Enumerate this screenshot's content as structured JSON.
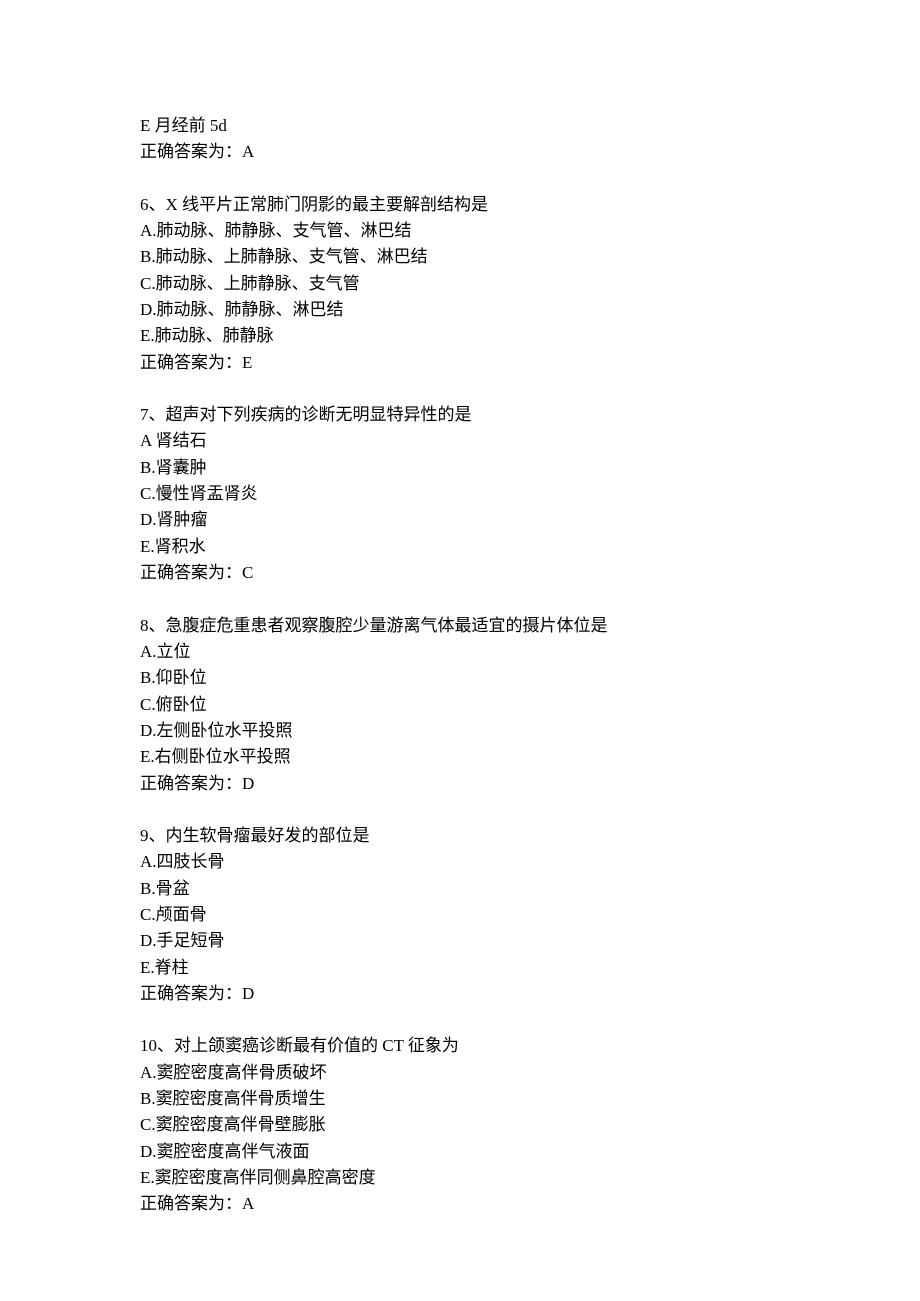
{
  "questions": [
    {
      "num": "",
      "stem": "E 月经前 5d",
      "options": [],
      "answer_label": "正确答案为：",
      "answer": "A"
    },
    {
      "num": "6、",
      "stem": "X 线平片正常肺门阴影的最主要解剖结构是",
      "options": [
        "A.肺动脉、肺静脉、支气管、淋巴结",
        "B.肺动脉、上肺静脉、支气管、淋巴结",
        "C.肺动脉、上肺静脉、支气管",
        "D.肺动脉、肺静脉、淋巴结",
        "E.肺动脉、肺静脉"
      ],
      "answer_label": "正确答案为：",
      "answer": "E"
    },
    {
      "num": "7、",
      "stem": "超声对下列疾病的诊断无明显特异性的是",
      "options": [
        "A 肾结石",
        "B.肾囊肿",
        "C.慢性肾盂肾炎",
        "D.肾肿瘤",
        "E.肾积水"
      ],
      "answer_label": "正确答案为：",
      "answer": "C"
    },
    {
      "num": "8、",
      "stem": "急腹症危重患者观察腹腔少量游离气体最适宜的摄片体位是",
      "options": [
        "A.立位",
        "B.仰卧位",
        "C.俯卧位",
        "D.左侧卧位水平投照",
        "E.右侧卧位水平投照"
      ],
      "answer_label": "正确答案为：",
      "answer": "D"
    },
    {
      "num": "9、",
      "stem": "内生软骨瘤最好发的部位是",
      "options": [
        "A.四肢长骨",
        "B.骨盆",
        "C.颅面骨",
        "D.手足短骨",
        "E.脊柱"
      ],
      "answer_label": "正确答案为：",
      "answer": "D"
    },
    {
      "num": "10、",
      "stem": "对上颌窦癌诊断最有价值的 CT 征象为",
      "options": [
        "A.窦腔密度高伴骨质破坏",
        "B.窦腔密度高伴骨质增生",
        "C.窦腔密度高伴骨壁膨胀",
        "D.窦腔密度高伴气液面",
        "E.窦腔密度高伴同侧鼻腔高密度"
      ],
      "answer_label": "正确答案为：",
      "answer": "A"
    }
  ]
}
